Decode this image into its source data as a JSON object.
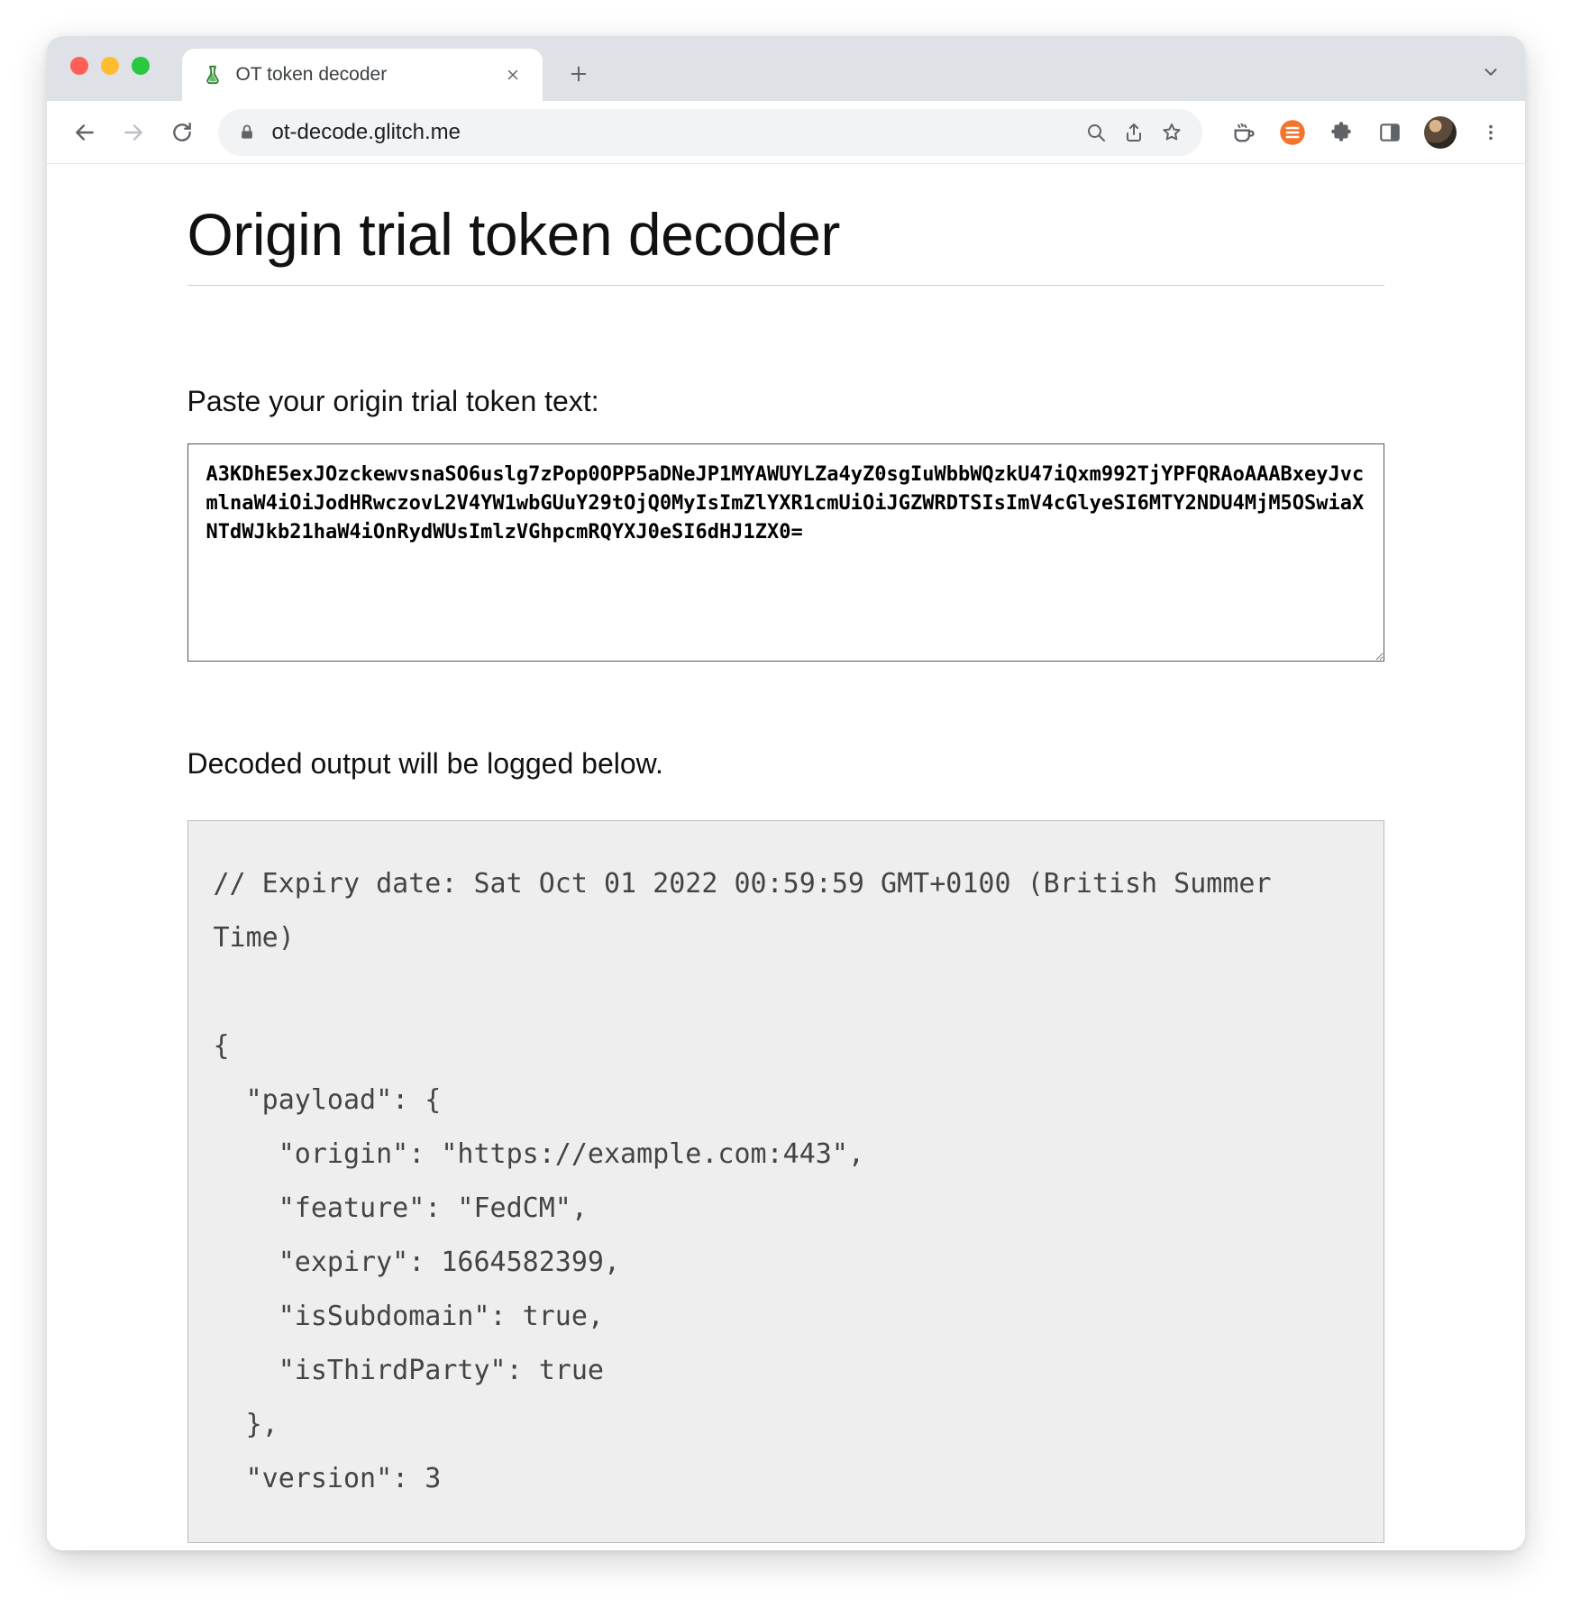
{
  "window": {
    "tab_title": "OT token decoder",
    "url": "ot-decode.glitch.me"
  },
  "page": {
    "title": "Origin trial token decoder",
    "input_label": "Paste your origin trial token text:",
    "token_value": "A3KDhE5exJOzckewvsnaSO6uslg7zPop0OPP5aDNeJP1MYAWUYLZa4yZ0sgIuWbbWQzkU47iQxm992TjYPFQRAoAAABxeyJvcmlnaW4iOiJodHRwczovL2V4YW1wbGUuY29tOjQ0MyIsImZlYXR1cmUiOiJGZWRDTSIsImV4cGlyeSI6MTY2NDU4MjM5OSwiaXNTdWJkb21haW4iOnRydWUsImlzVGhpcmRQYXJ0eSI6dHJ1ZX0=",
    "output_label": "Decoded output will be logged below.",
    "decoded_output": "// Expiry date: Sat Oct 01 2022 00:59:59 GMT+0100 (British Summer Time)\n\n{\n  \"payload\": {\n    \"origin\": \"https://example.com:443\",\n    \"feature\": \"FedCM\",\n    \"expiry\": 1664582399,\n    \"isSubdomain\": true,\n    \"isThirdParty\": true\n  },\n  \"version\": 3"
  },
  "decoded_token": {
    "expiry_human": "Sat Oct 01 2022 00:59:59 GMT+0100 (British Summer Time)",
    "payload": {
      "origin": "https://example.com:443",
      "feature": "FedCM",
      "expiry": 1664582399,
      "isSubdomain": true,
      "isThirdParty": true
    },
    "version": 3
  },
  "icons": {
    "favicon": "test-tube-icon"
  }
}
